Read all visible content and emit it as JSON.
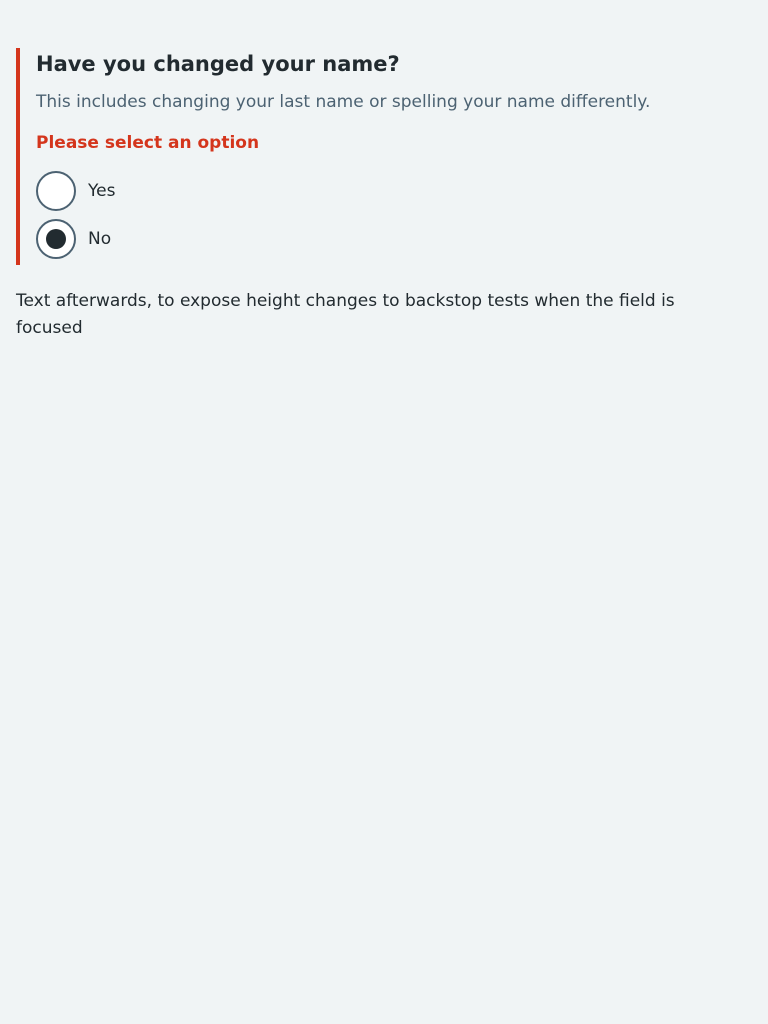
{
  "question": {
    "legend": "Have you changed your name?",
    "hint": "This includes changing your last name or spelling your name differently.",
    "error": "Please select an option",
    "options": [
      {
        "label": "Yes",
        "selected": false
      },
      {
        "label": "No",
        "selected": true
      }
    ]
  },
  "after_text": "Text afterwards, to expose height changes to backstop tests when the field is focused",
  "colors": {
    "background": "#f0f4f5",
    "error": "#d4351c",
    "text": "#222b30",
    "hint": "#4c6272"
  }
}
